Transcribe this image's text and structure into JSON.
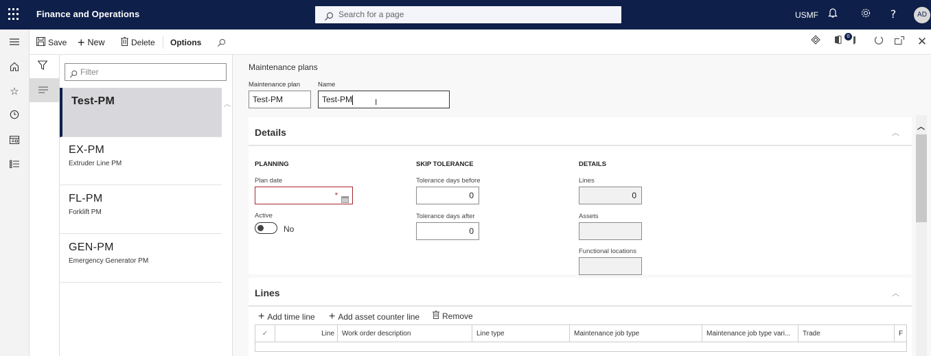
{
  "topbar": {
    "app_title": "Finance and Operations",
    "search_placeholder": "Search for a page",
    "company": "USMF",
    "avatar_initials": "AD",
    "icons": [
      "app-launcher-icon",
      "bell-icon",
      "gear-icon",
      "help-icon"
    ]
  },
  "actionbar": {
    "save": "Save",
    "new": "New",
    "delete": "Delete",
    "options": "Options",
    "notification_count": "0"
  },
  "nav_rail": [
    "hamburger-icon",
    "home-icon",
    "star-icon",
    "clock-icon",
    "workspace-icon",
    "list-icon"
  ],
  "list": {
    "filter_placeholder": "Filter",
    "items": [
      {
        "title": "Test-PM",
        "subtitle": "",
        "selected": true
      },
      {
        "title": "EX-PM",
        "subtitle": "Extruder Line PM"
      },
      {
        "title": "FL-PM",
        "subtitle": "Forklift PM"
      },
      {
        "title": "GEN-PM",
        "subtitle": "Emergency Generator PM"
      }
    ]
  },
  "header": {
    "breadcrumb": "Maintenance plans",
    "plan_label": "Maintenance plan",
    "plan_value": "Test-PM",
    "name_label": "Name",
    "name_value": "Test-PM"
  },
  "details": {
    "title": "Details",
    "planning": {
      "title": "PLANNING",
      "plan_date_label": "Plan date",
      "plan_date_value": "",
      "active_label": "Active",
      "active_value": "No"
    },
    "skip_tolerance": {
      "title": "SKIP TOLERANCE",
      "before_label": "Tolerance days before",
      "before_value": "0",
      "after_label": "Tolerance days after",
      "after_value": "0"
    },
    "details_group": {
      "title": "DETAILS",
      "lines_label": "Lines",
      "lines_value": "0",
      "assets_label": "Assets",
      "assets_value": "",
      "functional_label": "Functional locations",
      "functional_value": ""
    }
  },
  "lines": {
    "title": "Lines",
    "add_time_line": "Add time line",
    "add_asset_counter_line": "Add asset counter line",
    "remove": "Remove",
    "columns": [
      "Line",
      "Work order description",
      "Line type",
      "Maintenance job type",
      "Maintenance job type vari...",
      "Trade",
      "F"
    ]
  }
}
